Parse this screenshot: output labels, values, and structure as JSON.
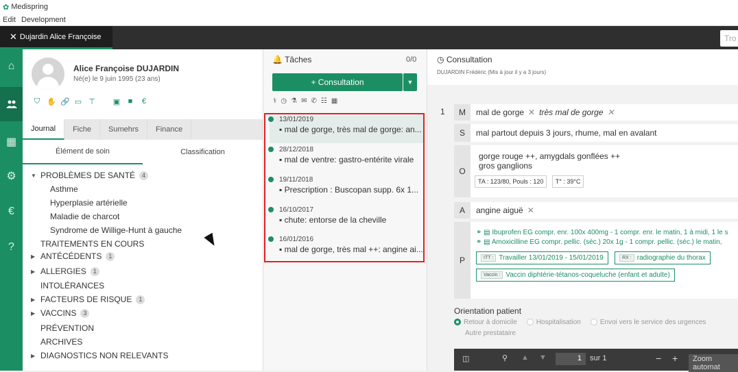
{
  "app": {
    "title": "Medispring"
  },
  "menu": [
    "Edit",
    "Development"
  ],
  "tab": {
    "label": "Dujardin Alice Françoise",
    "close": "✕"
  },
  "search": {
    "placeholder": "Tro"
  },
  "leftnav": [
    {
      "icon": "home-icon",
      "glyph": "⌂"
    },
    {
      "icon": "patients-icon",
      "glyph": "👥"
    },
    {
      "icon": "calendar-icon",
      "glyph": "▦"
    },
    {
      "icon": "settings-icon",
      "glyph": "⚙"
    },
    {
      "icon": "euro-icon",
      "glyph": "€"
    },
    {
      "icon": "help-icon",
      "glyph": "?"
    }
  ],
  "patient": {
    "name": "Alice Françoise DUJARDIN",
    "birth": "Né(e) le 9 juin 1995 (23 ans)",
    "icons": [
      "shield-icon",
      "handshake-icon",
      "link-icon",
      "folder-icon",
      "hierarchy-icon",
      "calculator-icon",
      "book-icon",
      "euro-icon"
    ]
  },
  "journal_tabs": [
    "Journal",
    "Fiche",
    "Sumehrs",
    "Finance"
  ],
  "subtabs": [
    "Élément de soin",
    "Classification"
  ],
  "tree": {
    "problems": {
      "label": "PROBLÈMES DE SANTÉ",
      "count": "4"
    },
    "problem_items": [
      "Asthme",
      "Hyperplasie artérielle",
      "Maladie de charcot",
      "Syndrome de Willige-Hunt à gauche"
    ],
    "traitements": "TRAITEMENTS EN COURS",
    "antecedents": {
      "label": "ANTÉCÉDENTS",
      "count": "1"
    },
    "allergies": {
      "label": "ALLERGIES",
      "count": "1"
    },
    "intolerances": "INTOLÉRANCES",
    "facteurs": {
      "label": "FACTEURS DE RISQUE",
      "count": "1"
    },
    "vaccins": {
      "label": "VACCINS",
      "count": "3"
    },
    "prevention": "PRÉVENTION",
    "archives": "ARCHIVES",
    "diagnostics": "DIAGNOSTICS NON RELEVANTS"
  },
  "tasks": {
    "title": "Tâches",
    "count": "0/0",
    "button": "+ Consultation",
    "dropdown": "▼",
    "items": [
      {
        "date": "13/01/2019",
        "text": "▪ mal de gorge, très mal de gorge: an..."
      },
      {
        "date": "28/12/2018",
        "text": "▪ mal de ventre: gastro-entérite virale"
      },
      {
        "date": "19/11/2018",
        "text": "▪ Prescription : Buscopan supp. 6x 1..."
      },
      {
        "date": "16/10/2017",
        "text": "▪ chute: entorse de la cheville"
      },
      {
        "date": "16/01/2016",
        "text": "▪ mal de gorge, très mal ++: angine ai..."
      }
    ]
  },
  "consultation": {
    "title": "Consultation",
    "sub": "DUJARDIN Frédéric (Mis à jour il y a 3 jours)",
    "row": "1",
    "M": {
      "letter": "M",
      "chips": [
        "mal de gorge",
        "très mal de gorge"
      ]
    },
    "S": {
      "letter": "S",
      "text": "mal partout depuis 3 jours, rhume, mal en avalant"
    },
    "O": {
      "letter": "O",
      "line1": "gorge rouge ++, amygdals gonflées ++",
      "line2": "gros ganglions",
      "vital1": "TA : 123/80, Pouls : 120",
      "vital2": "T° : 39°C"
    },
    "A": {
      "letter": "A",
      "chip": "angine aiguë"
    },
    "P": {
      "letter": "P",
      "rx1": "Ibuprofen EG compr. enr. 100x 400mg - 1 compr. enr. le matin, 1 à midi, 1 le s",
      "rx2": "Amoxicilline EG compr. pellic. (séc.) 20x 1g - 1 compr. pellic. (séc.) le matin,",
      "itt_tag": "ITT :",
      "itt": "Travailler 13/01/2019 - 15/01/2019",
      "rx_tag": "RX :",
      "rx": "radiographie du thorax",
      "vaccin_tag": "Vaccin :",
      "vaccin": "Vaccin diphtérie-tétanos-coqueluche (enfant et adulte)"
    },
    "orientation": {
      "title": "Orientation patient",
      "options": [
        "Retour à domicile",
        "Hospitalisation",
        "Envoi vers le service des urgences"
      ],
      "option2": "Autre prestataire"
    },
    "pdf": {
      "page": "1",
      "of": "sur 1",
      "zoom": "Zoom automat"
    }
  },
  "colors": {
    "accent": "#1b8f63",
    "highlight_border": "#e02020"
  }
}
